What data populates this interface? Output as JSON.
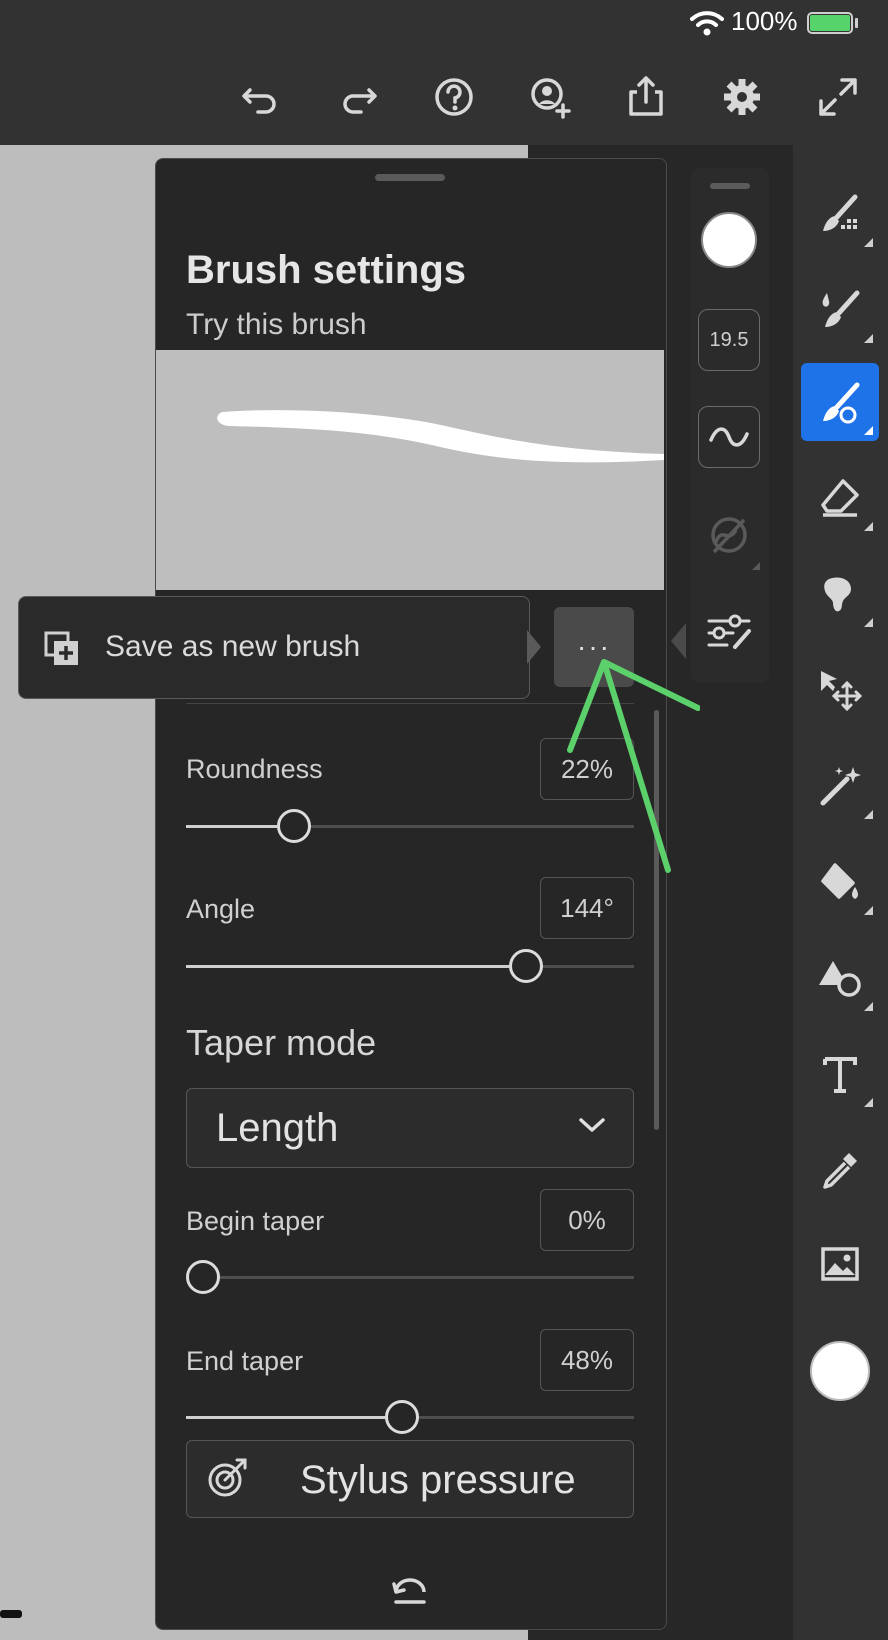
{
  "status": {
    "battery_text": "100%"
  },
  "toolbar": {
    "icons": [
      "undo-icon",
      "redo-icon",
      "help-icon",
      "add-user-icon",
      "share-icon",
      "gear-icon",
      "fullscreen-icon"
    ]
  },
  "quick_options": {
    "size_value": "19.5"
  },
  "panel": {
    "title": "Brush settings",
    "subtitle": "Try this brush"
  },
  "popover": {
    "save_label": "Save as new brush",
    "more_label": "···"
  },
  "settings": {
    "roundness": {
      "label": "Roundness",
      "value": "22%",
      "level": 0.22
    },
    "angle": {
      "label": "Angle",
      "value": "144°",
      "level": 0.78
    },
    "taper_mode": {
      "heading": "Taper mode",
      "selected": "Length"
    },
    "begin_taper": {
      "label": "Begin taper",
      "value": "0%",
      "level": 0.0
    },
    "end_taper": {
      "label": "End taper",
      "value": "48%",
      "level": 0.48
    },
    "stylus_label": "Stylus pressure"
  },
  "colors": {
    "accent": "#1f73e8",
    "annotation_arrow": "#5bd06b"
  }
}
